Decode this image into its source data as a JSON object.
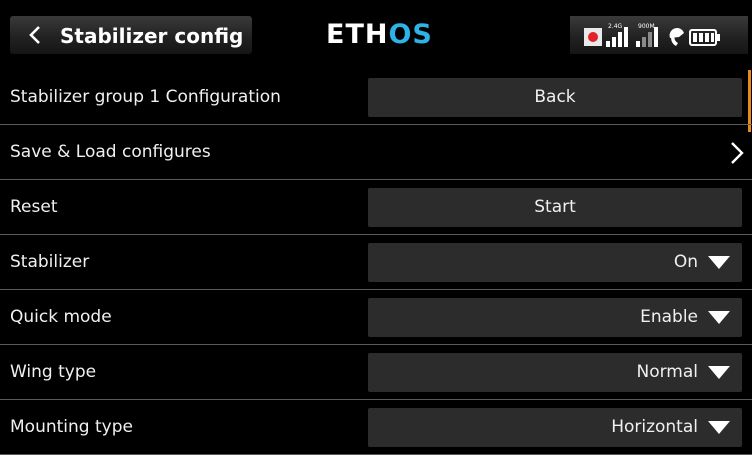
{
  "header": {
    "title": "Stabilizer config",
    "logo_part1": "ETH",
    "logo_part2": "OS",
    "accent_color": "#2db3e6",
    "signal_2g4_label": "2.4G",
    "signal_900m_label": "900M",
    "icons": [
      "back-arrow-icon",
      "record-icon",
      "signal-2g4-icon",
      "signal-900m-icon",
      "telemetry-icon",
      "battery-icon"
    ]
  },
  "rows": [
    {
      "label": "Stabilizer group 1 Configuration",
      "button": "Back"
    },
    {
      "label": "Save & Load configures"
    },
    {
      "label": "Reset",
      "button": "Start"
    },
    {
      "label": "Stabilizer",
      "value": "On"
    },
    {
      "label": "Quick mode",
      "value": "Enable"
    },
    {
      "label": "Wing type",
      "value": "Normal"
    },
    {
      "label": "Mounting type",
      "value": "Horizontal"
    }
  ],
  "colors": {
    "scroll_indicator": "#e88a1a",
    "record": "#e0222a"
  }
}
